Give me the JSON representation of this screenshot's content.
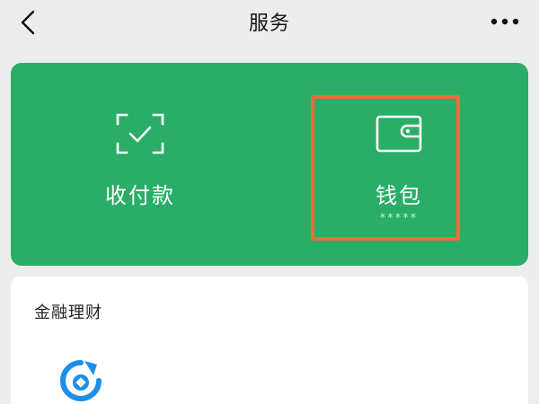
{
  "header": {
    "title": "服务"
  },
  "pay_section": {
    "items": [
      {
        "label": "收付款",
        "icon": "qr-scan-check-icon"
      },
      {
        "label": "钱包",
        "icon": "wallet-icon",
        "balance": "*****"
      }
    ]
  },
  "finance": {
    "title": "金融理财",
    "apps": [
      {
        "icon": "licaitong-icon"
      }
    ]
  },
  "colors": {
    "card_green": "#2aae67",
    "highlight": "#f06a3a",
    "background": "#ededed",
    "accent_blue": "#1e8fe8"
  }
}
